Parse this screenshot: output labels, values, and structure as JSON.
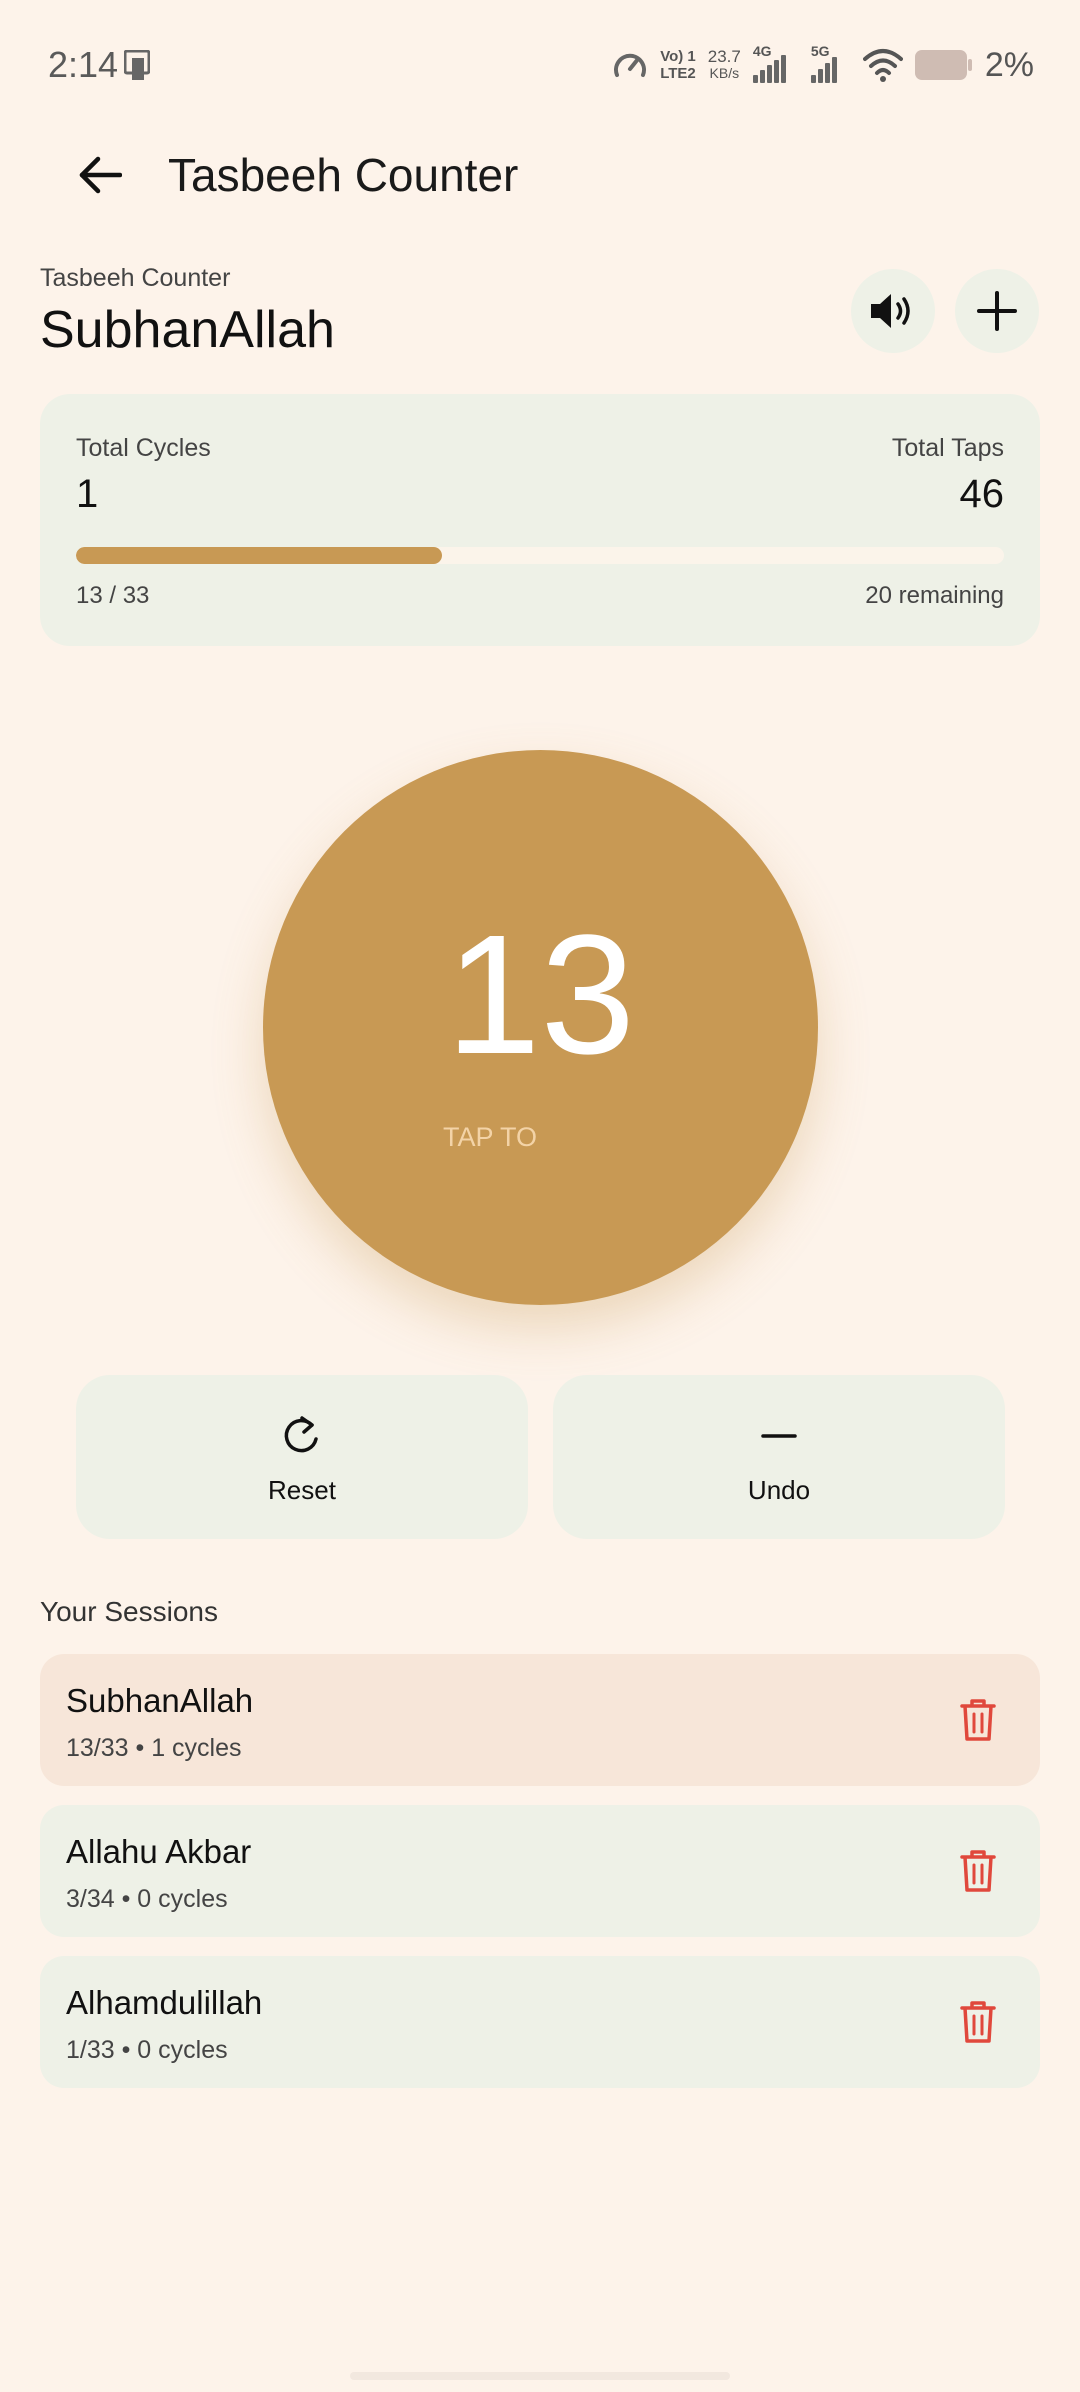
{
  "status_bar": {
    "time": "2:14",
    "volte_line1": "Vo) 1",
    "volte_line2": "LTE2",
    "net_rate": "23.7",
    "net_rate_unit": "KB/s",
    "net1": "4G",
    "net2": "5G",
    "battery": "2%"
  },
  "app_bar": {
    "title": "Tasbeeh Counter",
    "back_icon": "arrow-left-icon"
  },
  "header": {
    "subtitle": "Tasbeeh Counter",
    "session_name": "SubhanAllah",
    "sound_icon": "speaker-icon",
    "add_icon": "plus-icon"
  },
  "stats": {
    "total_cycles_label": "Total Cycles",
    "total_cycles": "1",
    "total_taps_label": "Total Taps",
    "total_taps": "46",
    "progress_fraction": 0.394,
    "progress_text": "13 / 33",
    "remaining_text": "20 remaining"
  },
  "counter": {
    "count": "13",
    "tap_label": "TAP TO"
  },
  "actions": {
    "reset_label": "Reset",
    "undo_label": "Undo"
  },
  "sessions": {
    "title": "Your Sessions",
    "items": [
      {
        "name": "SubhanAllah",
        "meta": "13/33 • 1 cycles"
      },
      {
        "name": "Allahu Akbar",
        "meta": "3/34 • 0 cycles"
      },
      {
        "name": "Alhamdulillah",
        "meta": "1/33 • 0 cycles"
      }
    ]
  },
  "colors": {
    "background": "#fdf3ea",
    "accent": "#c89954",
    "card": "#eef1e7",
    "active_session": "#f7e6d9",
    "delete": "#e0483c"
  }
}
